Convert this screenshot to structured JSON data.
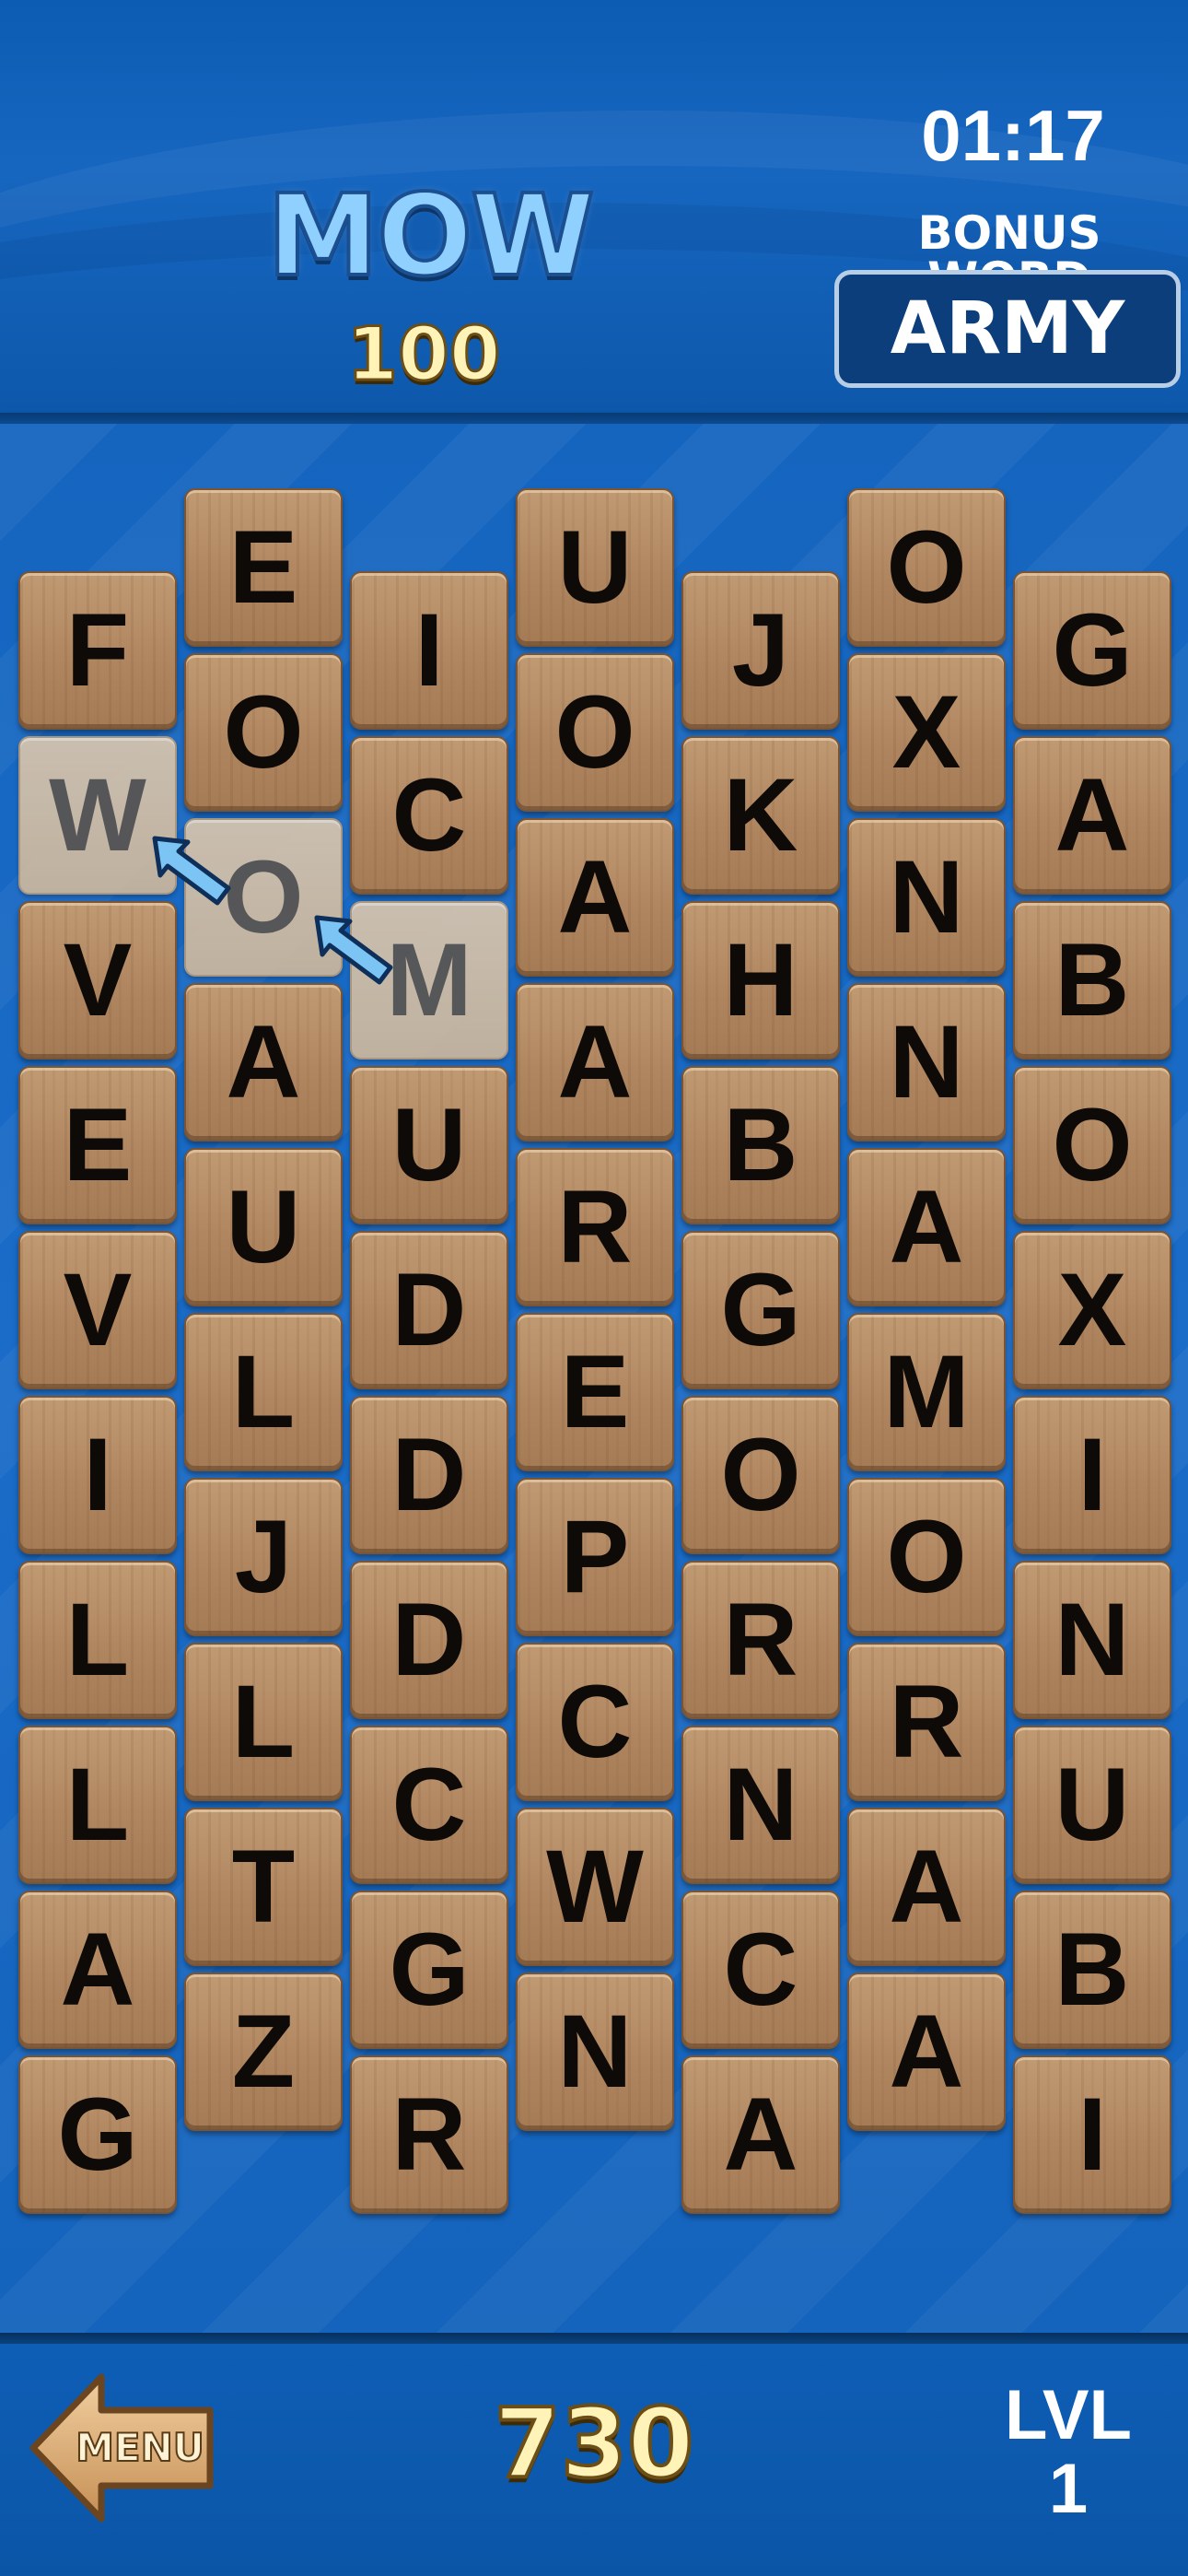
{
  "header": {
    "current_word": "MOW",
    "word_score": "100",
    "timer": "01:17",
    "bonus_label": "BONUS WORD",
    "bonus_word": "ARMY"
  },
  "board": {
    "columns": [
      [
        "F",
        "W",
        "V",
        "E",
        "V",
        "I",
        "L",
        "L",
        "A",
        "G"
      ],
      [
        "E",
        "O",
        "O",
        "A",
        "U",
        "L",
        "J",
        "L",
        "T",
        "Z"
      ],
      [
        "I",
        "C",
        "M",
        "U",
        "D",
        "D",
        "D",
        "C",
        "G",
        "R"
      ],
      [
        "U",
        "O",
        "A",
        "A",
        "R",
        "E",
        "P",
        "C",
        "W",
        "N"
      ],
      [
        "J",
        "K",
        "H",
        "B",
        "G",
        "O",
        "R",
        "N",
        "C",
        "A"
      ],
      [
        "O",
        "X",
        "N",
        "N",
        "A",
        "M",
        "O",
        "R",
        "A",
        "A"
      ],
      [
        "G",
        "A",
        "B",
        "O",
        "X",
        "I",
        "N",
        "U",
        "B",
        "I"
      ]
    ],
    "selected_path": [
      "W",
      "O",
      "M"
    ],
    "colors": {
      "tile": "#b08660",
      "tile_selected": "#d4bfa5",
      "letter": "#0d0a07",
      "arrow": "#7cc4f4"
    }
  },
  "footer": {
    "menu_label": "MENU",
    "total_score": "730",
    "level_label": "LVL",
    "level_value": "1"
  },
  "colors": {
    "background": "#0b5bb0",
    "word_color": "#8fd0ff",
    "score_color": "#fff3b8"
  }
}
